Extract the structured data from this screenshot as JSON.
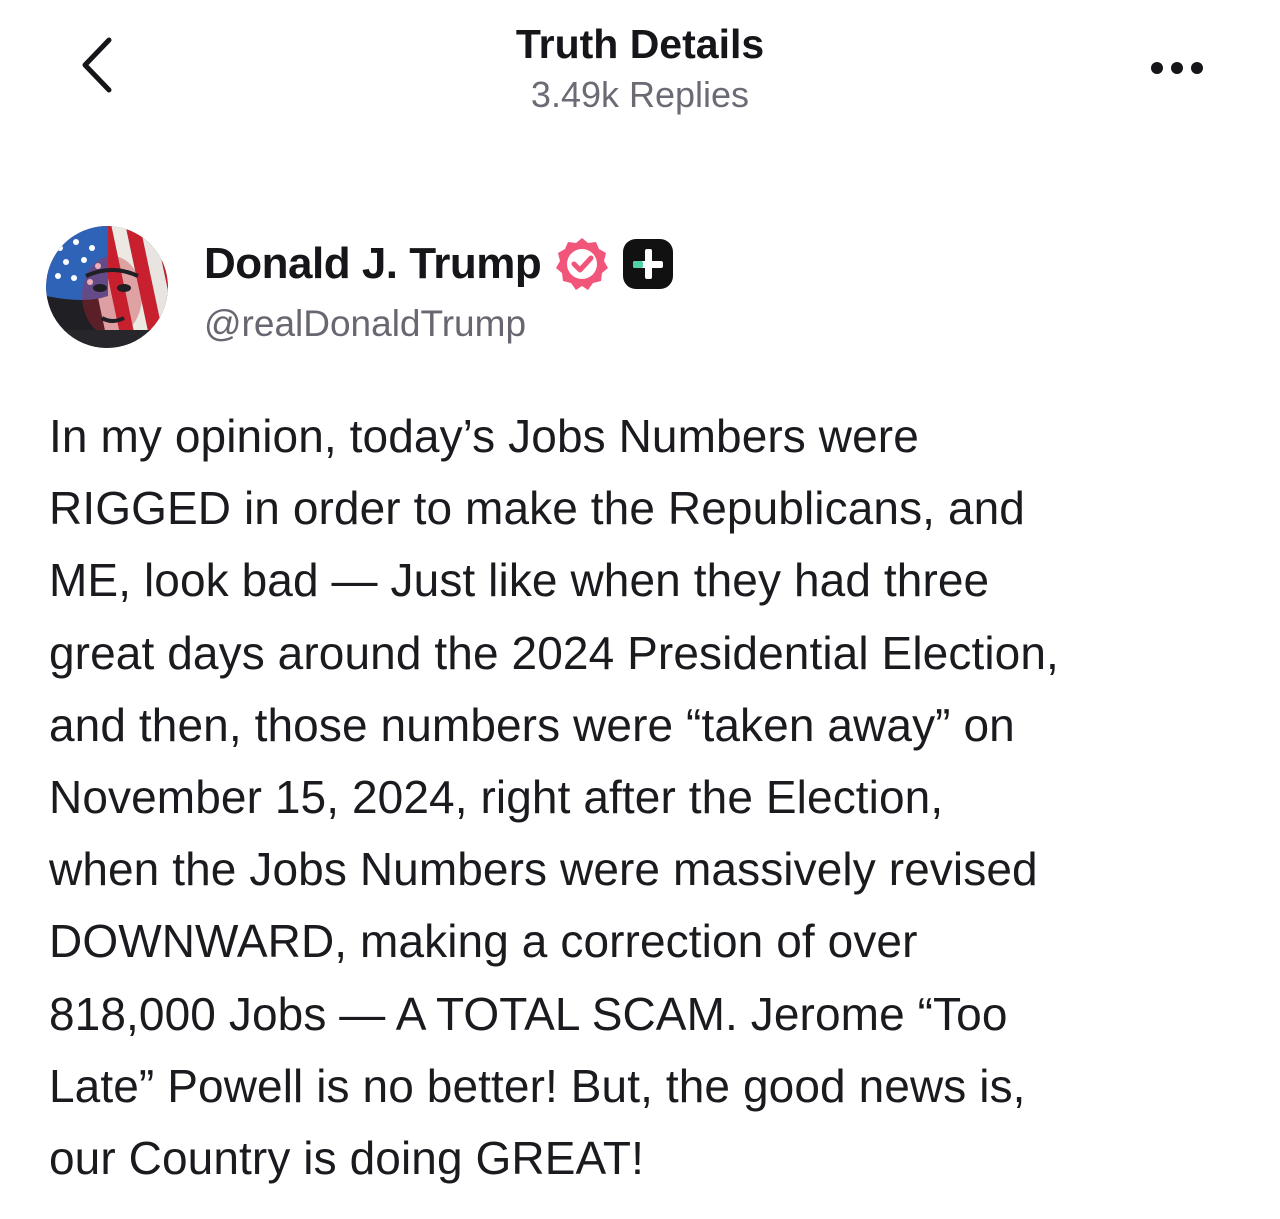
{
  "header": {
    "title": "Truth Details",
    "subtitle": "3.49k Replies",
    "back_icon": "chevron-left-icon",
    "more_icon": "more-horizontal-icon"
  },
  "author": {
    "name": "Donald J. Trump",
    "handle": "@realDonaldTrump",
    "verified_icon": "verified-badge-icon",
    "plus_icon": "truth-plus-icon",
    "avatar": "avatar-image"
  },
  "post": {
    "lines": [
      "In my opinion, today’s Jobs Numbers were",
      "RIGGED in order to make the Republicans, and",
      "ME, look bad — Just like when they had three",
      "great days around the 2024 Presidential Election,",
      "and then, those numbers were “taken away” on",
      "November 15, 2024, right after the Election,",
      "when the Jobs Numbers were massively revised",
      "DOWNWARD, making a correction of over",
      "818,000 Jobs — A TOTAL SCAM. Jerome “Too",
      "Late” Powell is no better! But, the good news is,",
      "our Country is doing GREAT!"
    ]
  },
  "colors": {
    "verified": "#f2557a",
    "plus_bg": "#111111",
    "plus_accent": "#4fd1a5",
    "text_primary": "#15151a",
    "text_secondary": "#6b6b75"
  }
}
